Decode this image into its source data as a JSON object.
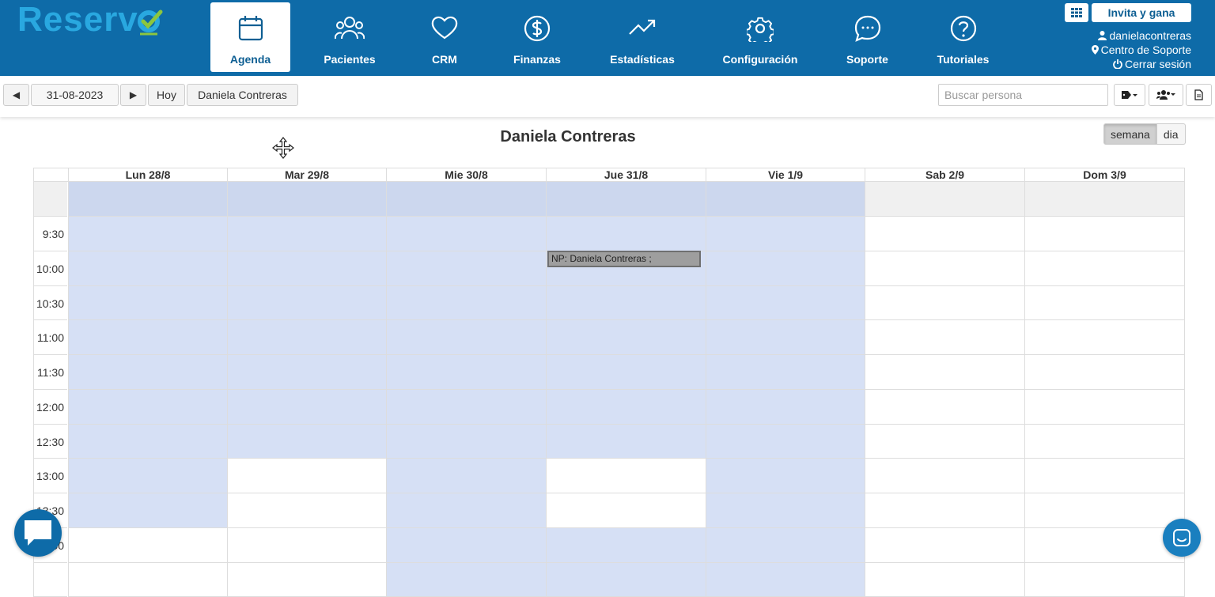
{
  "brand": {
    "logo_text": "Reserv"
  },
  "nav": {
    "items": [
      {
        "label": "Agenda",
        "icon": "calendar-icon",
        "active": true
      },
      {
        "label": "Pacientes",
        "icon": "users-icon"
      },
      {
        "label": "CRM",
        "icon": "heart-icon"
      },
      {
        "label": "Finanzas",
        "icon": "dollar-icon"
      },
      {
        "label": "Estadísticas",
        "icon": "trending-up-icon"
      },
      {
        "label": "Configuración",
        "icon": "gear-icon"
      },
      {
        "label": "Soporte",
        "icon": "chat-icon"
      },
      {
        "label": "Tutoriales",
        "icon": "help-icon"
      }
    ]
  },
  "account": {
    "invite_label": "Invita y gana",
    "username": "danielacontreras",
    "support_center": "Centro de Soporte",
    "logout": "Cerrar sesión"
  },
  "toolbar": {
    "prev_icon": "◀",
    "date": "31-08-2023",
    "next_icon": "▶",
    "today": "Hoy",
    "professional": "Daniela Contreras",
    "search_placeholder": "Buscar persona"
  },
  "calendar": {
    "title": "Daniela Contreras",
    "views": [
      "semana",
      "dia"
    ],
    "active_view": "semana",
    "days": [
      "Lun 28/8",
      "Mar 29/8",
      "Mie 30/8",
      "Jue 31/8",
      "Vie 1/9",
      "Sab 2/9",
      "Dom 3/9"
    ],
    "times": [
      "",
      "9:30",
      "10:00",
      "10:30",
      "11:00",
      "11:30",
      "12:00",
      "12:30",
      "13:00",
      "13:30",
      "14:00",
      ""
    ],
    "availability": [
      [
        1,
        1,
        1,
        1,
        1,
        1,
        1,
        1,
        1,
        1,
        0,
        0
      ],
      [
        1,
        1,
        1,
        1,
        1,
        1,
        1,
        1,
        0,
        0,
        0,
        0
      ],
      [
        1,
        1,
        1,
        1,
        1,
        1,
        1,
        1,
        1,
        1,
        1,
        1
      ],
      [
        1,
        1,
        1,
        1,
        1,
        1,
        1,
        1,
        0,
        0,
        1,
        1
      ],
      [
        1,
        1,
        1,
        1,
        1,
        1,
        1,
        1,
        1,
        1,
        1,
        1
      ],
      [
        0,
        0,
        0,
        0,
        0,
        0,
        0,
        0,
        0,
        0,
        0,
        0
      ],
      [
        0,
        0,
        0,
        0,
        0,
        0,
        0,
        0,
        0,
        0,
        0,
        0
      ]
    ],
    "event": {
      "text": "NP: Daniela Contreras ;",
      "day": "Jue 31/8",
      "time": "10:00"
    }
  },
  "colors": {
    "header_bg": "#0e6ba8",
    "logo": "#29a8e0",
    "logo_check": "#8cc63f",
    "available_slot": "#d6e0f5",
    "event_bg": "#9e9e9e"
  }
}
